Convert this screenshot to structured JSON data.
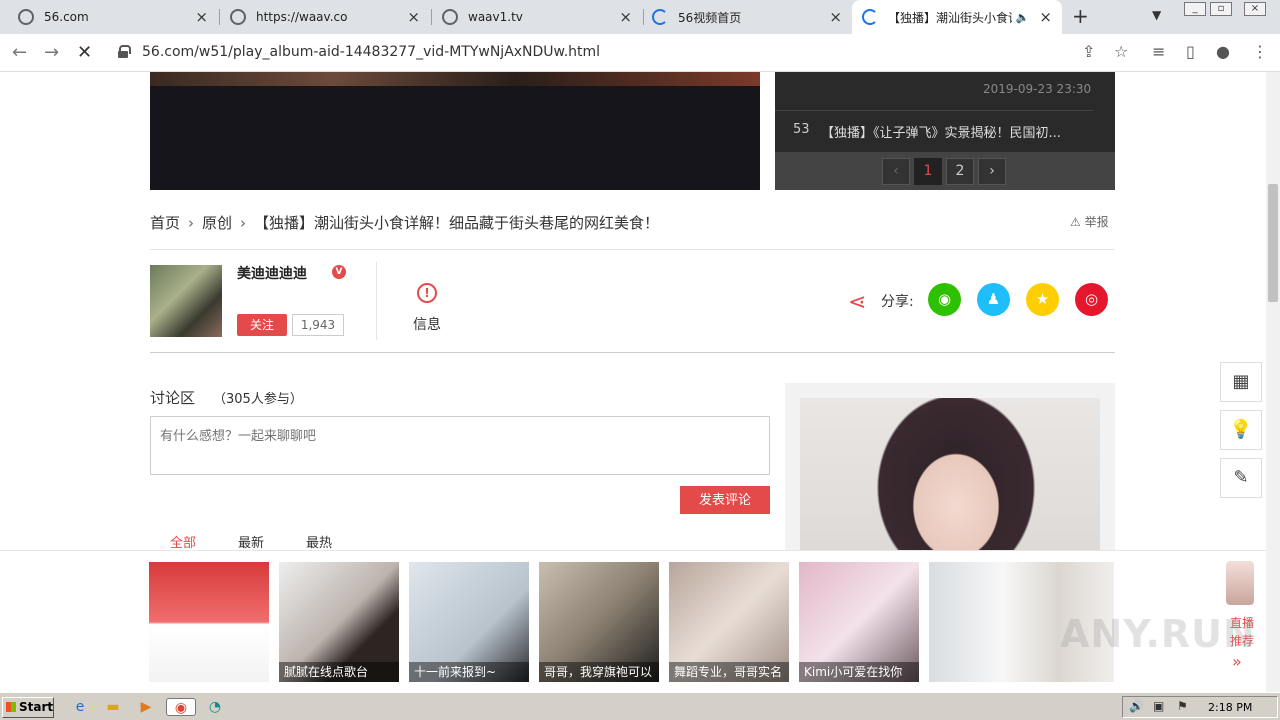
{
  "browser": {
    "tabs": [
      {
        "title": "56.com",
        "state": "normal"
      },
      {
        "title": "https://waav.co",
        "state": "normal"
      },
      {
        "title": "waav1.tv",
        "state": "normal"
      },
      {
        "title": "56视频首页",
        "state": "loading"
      },
      {
        "title": "【独播】潮汕街头小食详解",
        "state": "active-loading"
      }
    ],
    "url": "56.com/w51/play_album-aid-14483277_vid-MTYwNjAxNDUw.html",
    "icons": {
      "back": "back-arrow-icon",
      "forward": "forward-arrow-icon",
      "stop": "stop-x-icon",
      "lock": "lock-icon",
      "share": "share-icon",
      "bookmark": "star-icon",
      "queue": "reading-list-icon",
      "sidepanel": "side-panel-icon",
      "profile": "profile-icon",
      "menu": "kebab-menu-icon"
    }
  },
  "playlist": {
    "prev_date": "2019-09-23 23:30",
    "item_num": "53",
    "item_title": "【独播】《让子弹飞》实景揭秘！民国初...",
    "pages": [
      "1",
      "2"
    ],
    "current_page": "1"
  },
  "breadcrumb": {
    "home": "首页",
    "category": "原创",
    "title": "【独播】潮汕街头小食详解！细品藏于街头巷尾的网红美食！",
    "report": "举报"
  },
  "uploader": {
    "name": "美迪迪迪迪",
    "badge": "V",
    "follow_label": "关注",
    "followers": "1,943"
  },
  "info": {
    "icon_text": "!",
    "label": "信息"
  },
  "share": {
    "label": "分享:",
    "targets": [
      {
        "name": "wechat",
        "color": "#2dc100"
      },
      {
        "name": "qq",
        "color": "#1ebefa"
      },
      {
        "name": "qzone",
        "color": "#fece00"
      },
      {
        "name": "weibo",
        "color": "#e6162d"
      }
    ]
  },
  "discussion": {
    "title": "讨论区",
    "count": "（305人参与）",
    "placeholder": "有什么感想？一起来聊聊吧",
    "submit": "发表评论",
    "filters": [
      "全部",
      "最新",
      "最热"
    ],
    "active_filter": "全部"
  },
  "side_tools": [
    "qr-code-icon",
    "lightbulb-icon",
    "feedback-icon"
  ],
  "live_strip": {
    "thumbs": [
      {
        "caption": ""
      },
      {
        "caption": "腻腻在线点歌台"
      },
      {
        "caption": "十一前来报到~"
      },
      {
        "caption": "哥哥，我穿旗袍可以"
      },
      {
        "caption": "舞蹈专业，哥哥实名"
      },
      {
        "caption": "Kimi小可爱在找你"
      },
      {
        "caption": ""
      }
    ],
    "live_label": "直播推荐",
    "more": "»"
  },
  "watermark": "ANY.RUN",
  "taskbar": {
    "start": "Start",
    "clock": "2:18 PM"
  },
  "colors": {
    "accent": "#e34b4b",
    "active_tab": "#ffffff",
    "tabbar": "#dee1e6"
  }
}
